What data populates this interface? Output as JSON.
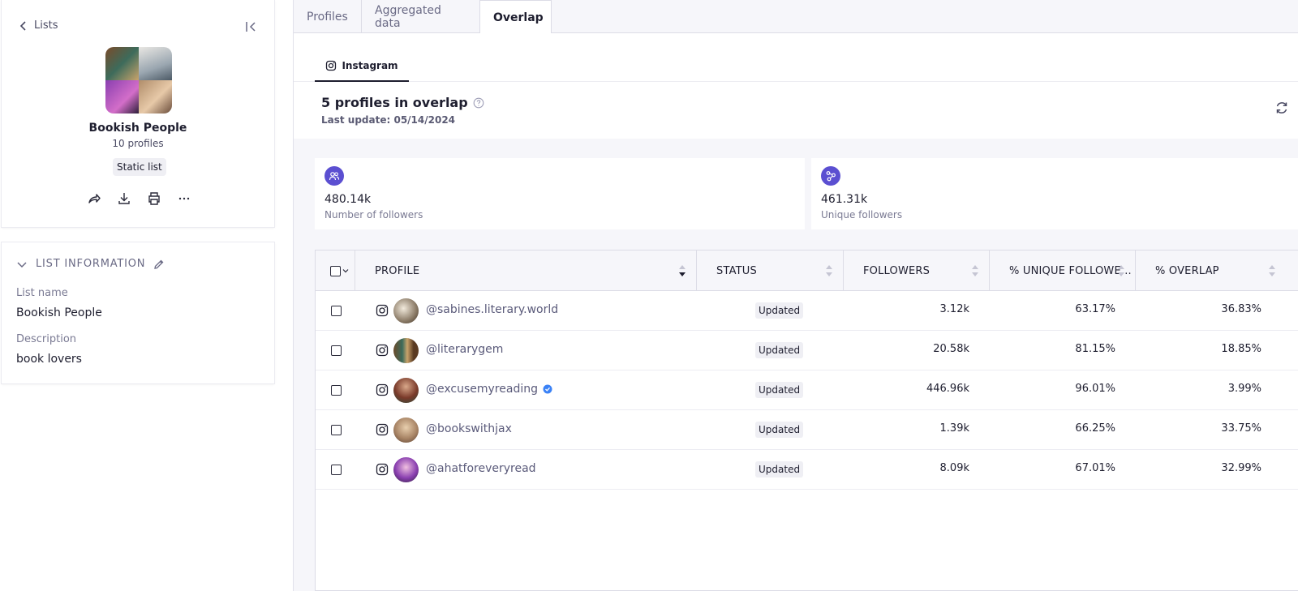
{
  "sidebar": {
    "back_label": "Lists",
    "list_title": "Bookish People",
    "list_count": "10 profiles",
    "list_type": "Static list",
    "info_heading": "LIST INFORMATION",
    "fields": [
      {
        "label": "List name",
        "value": "Bookish People"
      },
      {
        "label": "Description",
        "value": "book lovers"
      }
    ]
  },
  "tabs": [
    {
      "label": "Profiles"
    },
    {
      "label": "Aggregated data"
    },
    {
      "label": "Overlap",
      "active": true
    }
  ],
  "subtab": {
    "label": "Instagram"
  },
  "overlap": {
    "title": "5 profiles in overlap",
    "last_update": "Last update: 05/14/2024"
  },
  "stats": [
    {
      "value": "480.14k",
      "label": "Number of followers"
    },
    {
      "value": "461.31k",
      "label": "Unique followers"
    }
  ],
  "table": {
    "columns": [
      "PROFILE",
      "STATUS",
      "FOLLOWERS",
      "% UNIQUE FOLLOWE...",
      "% OVERLAP"
    ],
    "rows": [
      {
        "handle": "@sabines.literary.world",
        "verified": false,
        "status": "Updated",
        "followers": "3.12k",
        "unique": "63.17%",
        "overlap": "36.83%"
      },
      {
        "handle": "@literarygem",
        "verified": false,
        "status": "Updated",
        "followers": "20.58k",
        "unique": "81.15%",
        "overlap": "18.85%"
      },
      {
        "handle": "@excusemyreading",
        "verified": true,
        "status": "Updated",
        "followers": "446.96k",
        "unique": "96.01%",
        "overlap": "3.99%"
      },
      {
        "handle": "@bookswithjax",
        "verified": false,
        "status": "Updated",
        "followers": "1.39k",
        "unique": "66.25%",
        "overlap": "33.75%"
      },
      {
        "handle": "@ahatforeveryread",
        "verified": false,
        "status": "Updated",
        "followers": "8.09k",
        "unique": "67.01%",
        "overlap": "32.99%"
      }
    ]
  },
  "colors": {
    "accent": "#5b4fd1",
    "verified": "#3b82f6"
  }
}
